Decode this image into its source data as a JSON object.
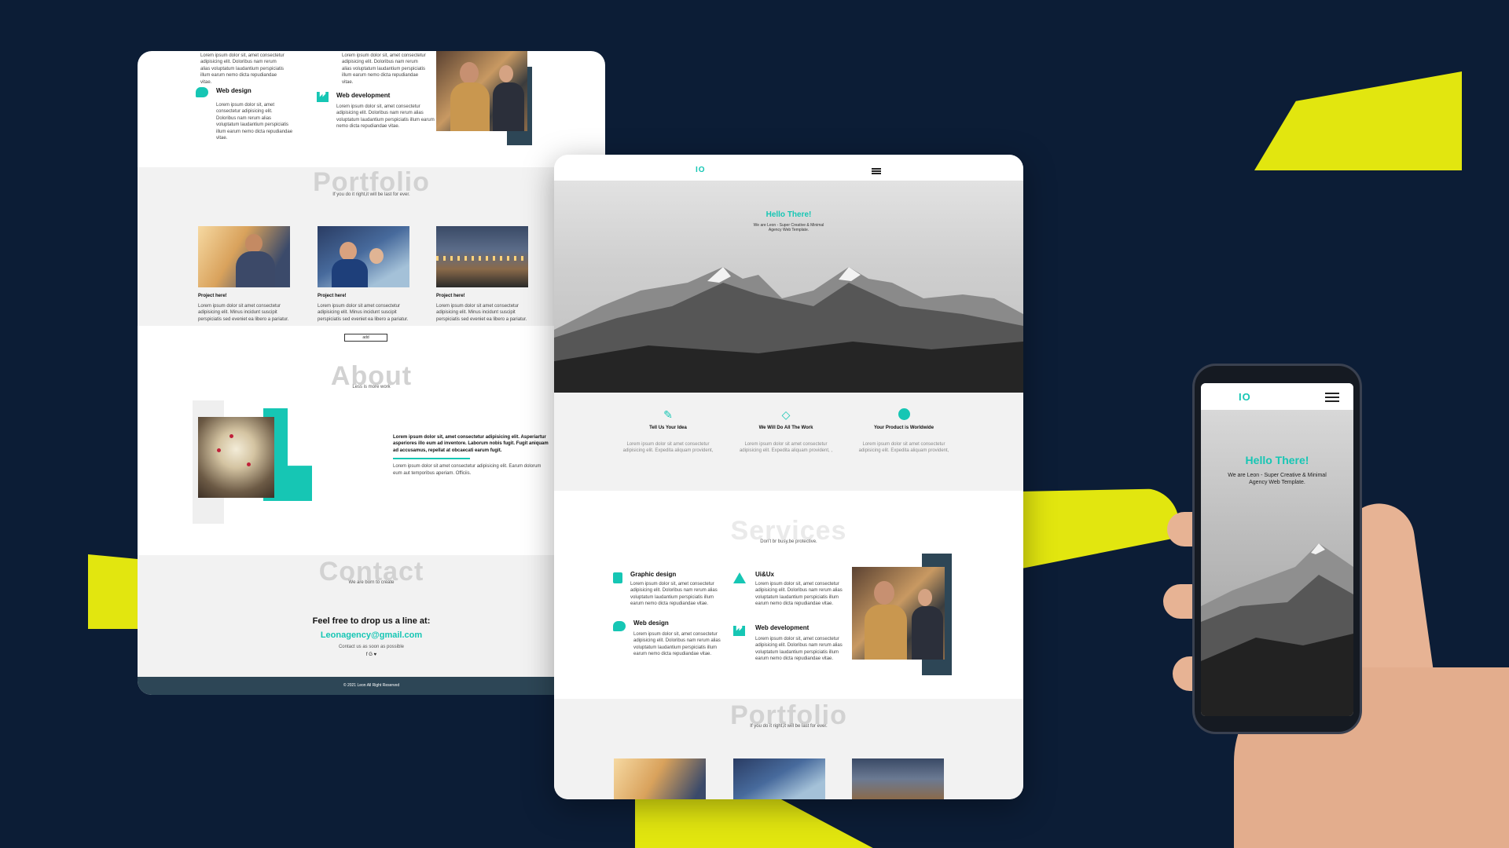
{
  "colors": {
    "background": "#0c1d36",
    "accent": "#16c6b4",
    "yellow": "#e2e60f",
    "dark": "#2d4656"
  },
  "winA": {
    "services": [
      {
        "title": "",
        "desc": "Lorem ipsum dolor sit, amet consectetur adipisicing elit. Doloribus nam rerum alias voluptatum laudantium perspiciatis illum earum nemo dicta repudiandae vitae."
      },
      {
        "title": "",
        "desc": "Lorem ipsum dolor sit, amet consectetur adipisicing elit. Doloribus nam rerum alias voluptatum laudantium perspiciatis illum earum nemo dicta repudiandae vitae."
      },
      {
        "title": "Web design",
        "icon": "chat-icon",
        "desc": "Lorem ipsum dolor sit, amet consectetur adipisicing elit. Doloribus nam rerum alias voluptatum laudantium perspiciatis illum earum nemo dicta repudiandae vitae."
      },
      {
        "title": "Web development",
        "icon": "chart-icon",
        "desc": "Lorem ipsum dolor sit, amet consectetur adipisicing elit. Doloribus nam rerum alias voluptatum laudantium perspiciatis illum earum nemo dicta repudiandae vitae."
      }
    ],
    "portfolio": {
      "heading": "Portfolio",
      "sub": "If you do it right,it will be last for ever.",
      "projects": [
        {
          "title": "Project here!",
          "desc": "Lorem ipsum dolor sit amet consectetur adipisicing elit. Minus incidunt suscipit perspiciatis sed eveniet ea libero a pariatur."
        },
        {
          "title": "Project here!",
          "desc": "Lorem ipsum dolor sit amet consectetur adipisicing elit. Minus incidunt suscipit perspiciatis sed eveniet ea libero a pariatur."
        },
        {
          "title": "Project here!",
          "desc": "Lorem ipsum dolor sit amet consectetur adipisicing elit. Minus incidunt suscipit perspiciatis sed eveniet ea libero a pariatur."
        }
      ],
      "button": "add"
    },
    "about": {
      "heading": "About",
      "sub": "Less is more work",
      "bold": "Lorem ipsum dolor sit, amet consectetur adipisicing elit. Asperiartur asperiores illo eum ad inventore. Laborum nobis fugit. Fugit aniquam ad accusamus, repellat at obcaecati earum fugit.",
      "text": "Lorem ipsum dolor sit amet consectetur adipisicing elit. Earum dolorum eum aut temporibus aperiam. Officiis."
    },
    "contact": {
      "heading": "Contact",
      "sub": "We are born to create",
      "line1": "Feel free to drop us a line at:",
      "email": "Leonagency@gmail.com",
      "small": "Contact us as soon as possible",
      "social": "f  G  ♥"
    },
    "footer": "© 2021 Leon All Right Reserved"
  },
  "winB": {
    "logo": "IO",
    "hero": {
      "title": "Hello There!",
      "line1": "We are Leon - Super Creative & Minimal",
      "line2": "Agency Web Template."
    },
    "features": [
      {
        "title": "Tell Us Your Idea",
        "icon": "magic-wand-icon",
        "desc": "Lorem ipsum dolor sit amet consectetur adipisicing elit. Expedita aliquam provident,"
      },
      {
        "title": "We Will Do All The Work",
        "icon": "diamond-icon",
        "desc": "Lorem ipsum dolor sit amet consectetur adipisicing elit. Expedita aliquam provident, ,"
      },
      {
        "title": "Your Product is Worldwide",
        "icon": "globe-icon",
        "desc": "Lorem ipsum dolor sit amet consectetur adipisicing elit. Expedita aliquam provident,"
      }
    ],
    "services": {
      "heading": "Services",
      "sub": "Don't br busy,be protective.",
      "items": [
        {
          "title": "Graphic design",
          "icon": "pen-tool-icon",
          "desc": "Lorem ipsum dolor sit, amet consectetur adipisicing elit. Doloribus nam rerum alias voluptatum laudantium perspiciatis illum earum nemo dicta repudiandae vitae."
        },
        {
          "title": "Ui&Ux",
          "icon": "tent-icon",
          "desc": "Lorem ipsum dolor sit, amet consectetur adipisicing elit. Doloribus nam rerum alias voluptatum laudantium perspiciatis illum earum nemo dicta repudiandae vitae."
        },
        {
          "title": "Web design",
          "icon": "chat-icon",
          "desc": "Lorem ipsum dolor sit, amet consectetur adipisicing elit. Doloribus nam rerum alias voluptatum laudantium perspiciatis illum earum nemo dicta repudiandae vitae."
        },
        {
          "title": "Web development",
          "icon": "chart-icon",
          "desc": "Lorem ipsum dolor sit, amet consectetur adipisicing elit. Doloribus nam rerum alias voluptatum laudantium perspiciatis illum earum nemo dicta repudiandae vitae."
        }
      ]
    },
    "portfolio": {
      "heading": "Portfolio",
      "sub": "If you do it right,it will be last for ever."
    }
  },
  "phone": {
    "logo": "IO",
    "title": "Hello There!",
    "line1": "We are Leon - Super Creative & Minimal",
    "line2": "Agency Web Template."
  }
}
